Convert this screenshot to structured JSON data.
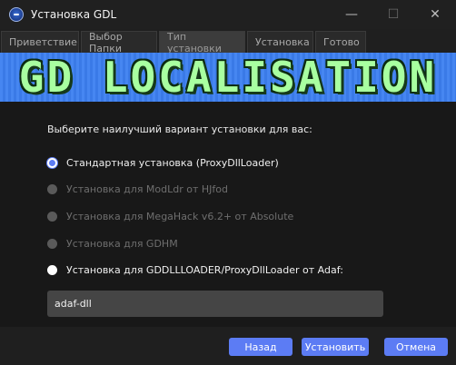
{
  "window": {
    "title": "Установка GDL",
    "minimize_symbol": "—",
    "maximize_symbol": "☐",
    "close_symbol": "✕"
  },
  "tabs": [
    {
      "label": "Приветствие",
      "active": false
    },
    {
      "label": "Выбор Папки",
      "active": false
    },
    {
      "label": "Тип установки",
      "active": true
    },
    {
      "label": "Установка",
      "active": false
    },
    {
      "label": "Готово",
      "active": false
    }
  ],
  "banner": {
    "text": "GD Localisation"
  },
  "main": {
    "prompt": "Выберите наилучший вариант установки для вас:",
    "options": [
      {
        "label": "Стандартная установка (ProxyDllLoader)",
        "state": "checked"
      },
      {
        "label": "Установка для ModLdr от HJfod",
        "state": "disabled"
      },
      {
        "label": "Установка для MegaHack v6.2+ от Absolute",
        "state": "disabled"
      },
      {
        "label": "Установка для GDHM",
        "state": "disabled"
      },
      {
        "label": "Установка для GDDLLLOADER/ProxyDllLoader от Adaf:",
        "state": "unchecked"
      }
    ],
    "dll_field_value": "adaf-dll"
  },
  "buttons": {
    "back": "Назад",
    "install": "Установить",
    "cancel": "Отмена"
  },
  "colors": {
    "accent": "#5c7cf4",
    "banner_bg": "#3c7ff0",
    "banner_text": "#a8ffa0"
  }
}
